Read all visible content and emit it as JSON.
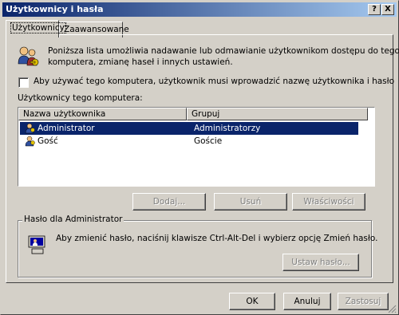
{
  "window": {
    "title": "Użytkownicy i hasła",
    "help_button": "?",
    "close_button": "X"
  },
  "tabs": [
    {
      "label": "Użytkownicy",
      "active": true
    },
    {
      "label": "Zaawansowane",
      "active": false
    }
  ],
  "intro_text_line1": "Poniższa lista umożliwia nadawanie lub odmawianie użytkownikom dostępu do tego",
  "intro_text_line2": "komputera, zmianę haseł i innych ustawień.",
  "require_login_checkbox": {
    "label": "Aby używać tego komputera, użytkownik musi wprowadzić nazwę użytkownika i hasło",
    "checked": false
  },
  "users_section_label": "Użytkownicy tego komputera:",
  "users_table": {
    "columns": [
      "Nazwa użytkownika",
      "Grupuj"
    ],
    "rows": [
      {
        "name": "Administrator",
        "group": "Administratorzy",
        "selected": true
      },
      {
        "name": "Gość",
        "group": "Goście",
        "selected": false
      }
    ]
  },
  "user_buttons": {
    "add": "Dodaj...",
    "remove": "Usuń",
    "properties": "Właściwości"
  },
  "password_group": {
    "title": "Hasło dla Administrator",
    "text": "Aby zmienić hasło, naciśnij klawisze Ctrl-Alt-Del i wybierz opcję Zmień hasło.",
    "set_password_button": "Ustaw hasło..."
  },
  "dialog_buttons": {
    "ok": "OK",
    "cancel": "Anuluj",
    "apply": "Zastosuj"
  },
  "colors": {
    "titlebar_start": "#0a246a",
    "titlebar_end": "#a6caf0",
    "selection": "#0a246a",
    "face": "#d4d0c8"
  }
}
